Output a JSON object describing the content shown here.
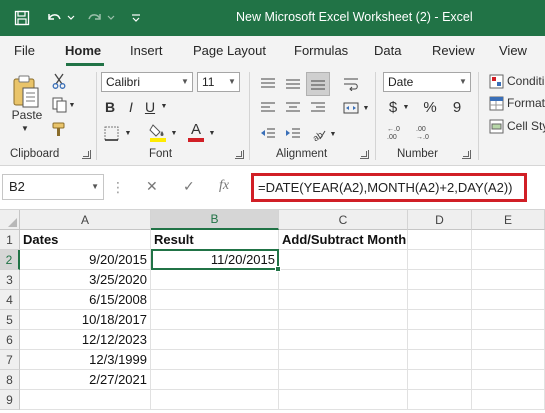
{
  "window": {
    "title": "New Microsoft Excel Worksheet (2)  -  Excel",
    "accent": "#217346"
  },
  "tabs": [
    "File",
    "Home",
    "Insert",
    "Page Layout",
    "Formulas",
    "Data",
    "Review",
    "View"
  ],
  "active_tab": "Home",
  "ribbon": {
    "clipboard": {
      "label": "Clipboard",
      "paste_label": "Paste"
    },
    "font": {
      "label": "Font",
      "font_name": "Calibri",
      "font_size": "11",
      "bold": "B",
      "italic": "I",
      "underline": "U",
      "grow": "A",
      "shrink": "A",
      "font_color_letter": "A"
    },
    "alignment": {
      "label": "Alignment"
    },
    "number": {
      "label": "Number",
      "format": "Date",
      "currency": "$",
      "percent": "%",
      "comma": "9"
    },
    "styles": {
      "conditional": "Conditi",
      "format_as": "Format",
      "cell_styles": "Cell Sty"
    }
  },
  "formula_bar": {
    "name_box": "B2",
    "formula": "=DATE(YEAR(A2),MONTH(A2)+2,DAY(A2))",
    "highlight_color": "#d11f26"
  },
  "sheet": {
    "columns": [
      "A",
      "B",
      "C",
      "D",
      "E"
    ],
    "selected_column": "B",
    "rows": [
      "1",
      "2",
      "3",
      "4",
      "5",
      "6",
      "7",
      "8",
      "9"
    ],
    "selected_row": "2",
    "headers": {
      "a1": "Dates",
      "b1": "Result",
      "c1": "Add/Subtract Month"
    },
    "dates": [
      "9/20/2015",
      "3/25/2020",
      "6/15/2008",
      "10/18/2017",
      "12/12/2023",
      "12/3/1999",
      "2/27/2021"
    ],
    "result_b2": "11/20/2015"
  }
}
